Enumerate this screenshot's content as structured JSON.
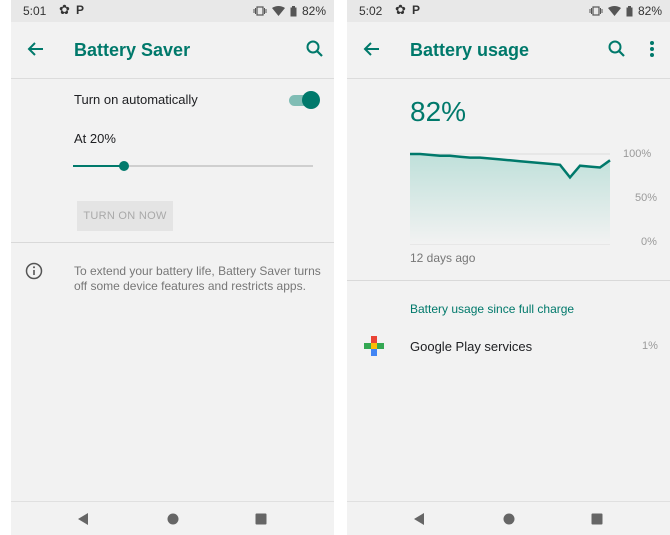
{
  "left": {
    "status": {
      "time": "5:01",
      "battery": "82%"
    },
    "title": "Battery Saver",
    "turn_on_auto_label": "Turn on automatically",
    "toggle_on": true,
    "threshold_label": "At 20%",
    "slider_level": 0.2,
    "turn_on_now_label": "TURN ON NOW",
    "info_text_line1": "To extend your battery life, Battery Saver turns",
    "info_text_line2": "off some device features and restricts apps."
  },
  "right": {
    "status": {
      "time": "5:02",
      "battery": "82%"
    },
    "title": "Battery usage",
    "battery_level": "82%",
    "chart_axis": {
      "top": "100%",
      "mid": "50%",
      "bottom": "0%"
    },
    "chart_start_label": "12 days ago",
    "section_title": "Battery usage since full charge",
    "apps": [
      {
        "name": "Google Play services",
        "percent": "1%"
      }
    ]
  },
  "chart_data": {
    "type": "area",
    "title": "",
    "xlabel": "",
    "ylabel": "",
    "x_start_label": "12 days ago",
    "ylim": [
      0,
      100
    ],
    "y_ticks": [
      "100%",
      "50%",
      "0%"
    ],
    "x": [
      0,
      1,
      2,
      3,
      4,
      5,
      6,
      7,
      8,
      9,
      10,
      11,
      12,
      13,
      14,
      15,
      16,
      17,
      18,
      19,
      20
    ],
    "values": [
      100,
      100,
      99,
      98,
      98,
      97,
      96,
      96,
      95,
      94,
      93,
      92,
      91,
      90,
      89,
      88,
      74,
      87,
      86,
      85,
      93
    ],
    "color": "#00796b"
  },
  "colors": {
    "accent": "#00796b",
    "background": "#f2f2f2"
  }
}
